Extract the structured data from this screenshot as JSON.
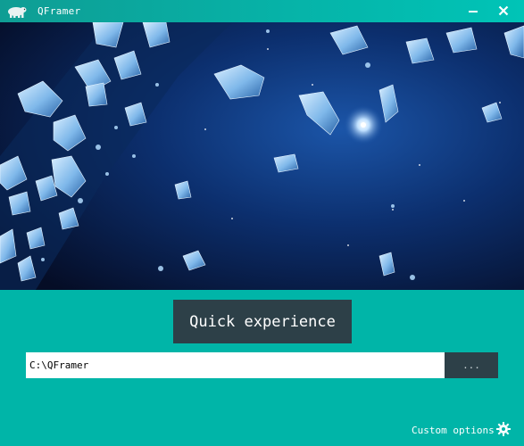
{
  "window": {
    "title": "QFramer",
    "icon": "polar-bear-icon",
    "minimize_icon": "minimize-icon",
    "close_icon": "close-icon"
  },
  "banner": {
    "subject": "space-asteroid-field-image"
  },
  "main": {
    "quick_experience_label": "Quick experience",
    "path_value": "C:\\QFramer",
    "browse_label": "...",
    "custom_options_label": "Custom options",
    "gear_icon": "gear-icon"
  },
  "colors": {
    "background": "#00b5a8",
    "button": "#2d4048",
    "text": "#ffffff"
  }
}
